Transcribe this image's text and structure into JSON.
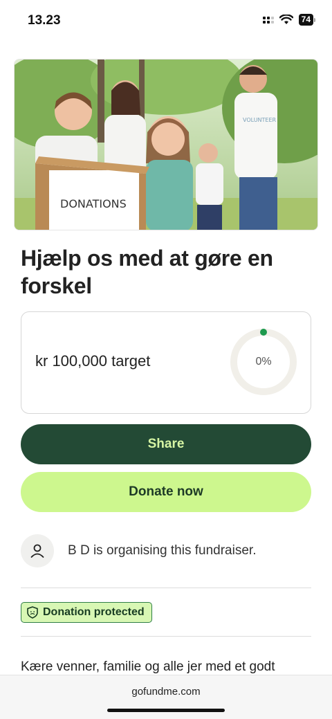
{
  "status_bar": {
    "time": "13.23",
    "battery": "74"
  },
  "hero": {
    "image_alt": "Children holding a donations box with volunteers",
    "box_text": "DONATIONS",
    "shirt_text": "VOLUNTEER"
  },
  "campaign": {
    "title": "Hjælp os med at gøre en forskel",
    "target_text": "kr 100,000 target",
    "progress_label": "0%",
    "progress": 0
  },
  "actions": {
    "share_label": "Share",
    "donate_label": "Donate now"
  },
  "organiser": {
    "text": "B D is organising this fundraiser."
  },
  "badge": {
    "label": "Donation protected"
  },
  "story": {
    "preview": "Kære venner, familie og alle jer med et godt"
  },
  "browser": {
    "url": "gofundme.com"
  },
  "colors": {
    "share_bg": "#234a35",
    "donate_bg": "#cdf78e",
    "progress_dot": "#1e9a4f"
  }
}
